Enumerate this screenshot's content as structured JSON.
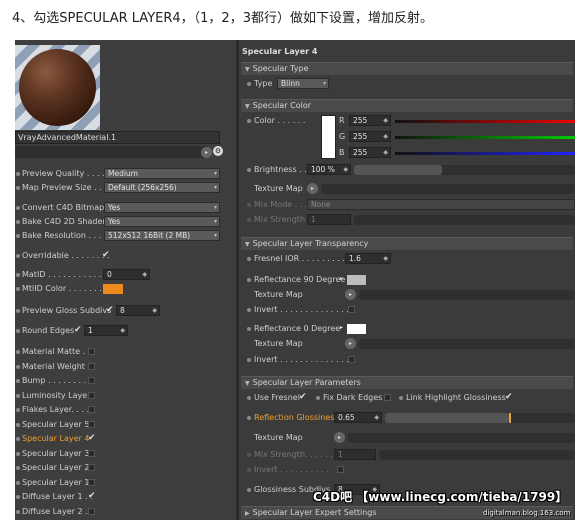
{
  "instruction": "4、勾选SPECULAR LAYER4，（1，2，3都行）做如下设置，增加反射。",
  "left_panel": {
    "material_name": "VrayAdvancedMaterial.1",
    "rows": [
      {
        "label": "Preview Quality . . . .",
        "value": "Medium"
      },
      {
        "label": "Map Preview Size . .",
        "value": "Default (256x256)"
      },
      {
        "label": "Convert C4D Bitmaps",
        "value": "Yes"
      },
      {
        "label": "Bake C4D 2D Shaders",
        "value": "Yes"
      },
      {
        "label": "Bake Resolution . . . . .",
        "value": "512x512  16Bit  (2 MB)"
      }
    ],
    "overridable": "Overridable . . . . . . . .",
    "matid_label": "MatID . . . . . . . . . . .",
    "matid_value": "0",
    "mtlid_color_label": "MtlID Color . . . . . . .",
    "mtlid_color": "#ee8a1a",
    "preview_gloss_label": "Preview Gloss Subdivs",
    "preview_gloss_value": "8",
    "round_edges_label": "Round Edges",
    "round_edges_value": "1",
    "layers": [
      {
        "label": "Material Matte . . .",
        "checked": false,
        "active": false
      },
      {
        "label": "Material Weight",
        "checked": false,
        "active": false
      },
      {
        "label": "Bump . . . . . . . . .",
        "checked": false,
        "active": false
      },
      {
        "label": "Luminosity Layer",
        "checked": false,
        "active": false
      },
      {
        "label": "Flakes Layer. . . . .",
        "checked": false,
        "active": false
      },
      {
        "label": "Specular Layer 5",
        "checked": false,
        "active": false
      },
      {
        "label": "Specular Layer 4",
        "checked": true,
        "active": true
      },
      {
        "label": "Specular Layer 3",
        "checked": false,
        "active": false
      },
      {
        "label": "Specular Layer 2",
        "checked": false,
        "active": false
      },
      {
        "label": "Specular Layer 1",
        "checked": false,
        "active": false
      },
      {
        "label": "Diffuse Layer 1 . .",
        "checked": true,
        "active": false
      },
      {
        "label": "Diffuse Layer 2 . .",
        "checked": false,
        "active": false
      }
    ]
  },
  "right_panel": {
    "title": "Specular Layer 4",
    "specular_type": {
      "header": "Specular Type",
      "type_label": "Type",
      "type_value": "Blinn"
    },
    "specular_color": {
      "header": "Specular Color",
      "color_label": "Color . . . . . .",
      "swatch": "#ffffff",
      "r_label": "R",
      "r_value": "255",
      "g_label": "G",
      "g_value": "255",
      "b_label": "B",
      "b_value": "255",
      "brightness_label": "Brightness . .",
      "brightness_value": "100 %",
      "texture_map_label": "Texture Map",
      "mix_mode_label": "Mix Mode . . .",
      "mix_mode_value": "None",
      "mix_strength_label": "Mix Strength",
      "mix_strength_value": "1"
    },
    "transparency": {
      "header": "Specular Layer Transparency",
      "fresnel_ior_label": "Fresnel IOR . . . . . . . . .",
      "fresnel_ior_value": "1.6",
      "refl90_label": "Reflectance 90 Degree",
      "refl90_color": "#bdbdbd",
      "texture_map_label": "Texture Map",
      "invert_label": "Invert . . . . . . . . . . . . . .",
      "refl0_label": "Reflectance  0 Degree",
      "refl0_color": "#ffffff",
      "texture_map2_label": "Texture Map",
      "invert2_label": "Invert . . . . . . . . . . . . . ."
    },
    "parameters": {
      "header": "Specular Layer Parameters",
      "use_fresnel": "Use Fresnel",
      "fix_dark_edges": "Fix Dark Edges",
      "link_highlight": "Link Highlight Glossiness",
      "refl_gloss_label": "Reflection Glossiness",
      "refl_gloss_value": "0.65",
      "refl_gloss_fraction": 0.65,
      "texture_map_label": "Texture Map",
      "mix_strength_label": "Mix Strength. . . . . .",
      "mix_strength_value": "1",
      "invert_label": "Invert . . . . . . . . . .",
      "gloss_subdivs_label": "Glossiness Subdivs",
      "gloss_subdivs_value": "8",
      "expert_header": "Specular Layer Expert Settings"
    }
  },
  "watermark": "C4D吧 【www.linecg.com/tieba/1799】",
  "watermark_small": "digitalman.blog.163.com"
}
